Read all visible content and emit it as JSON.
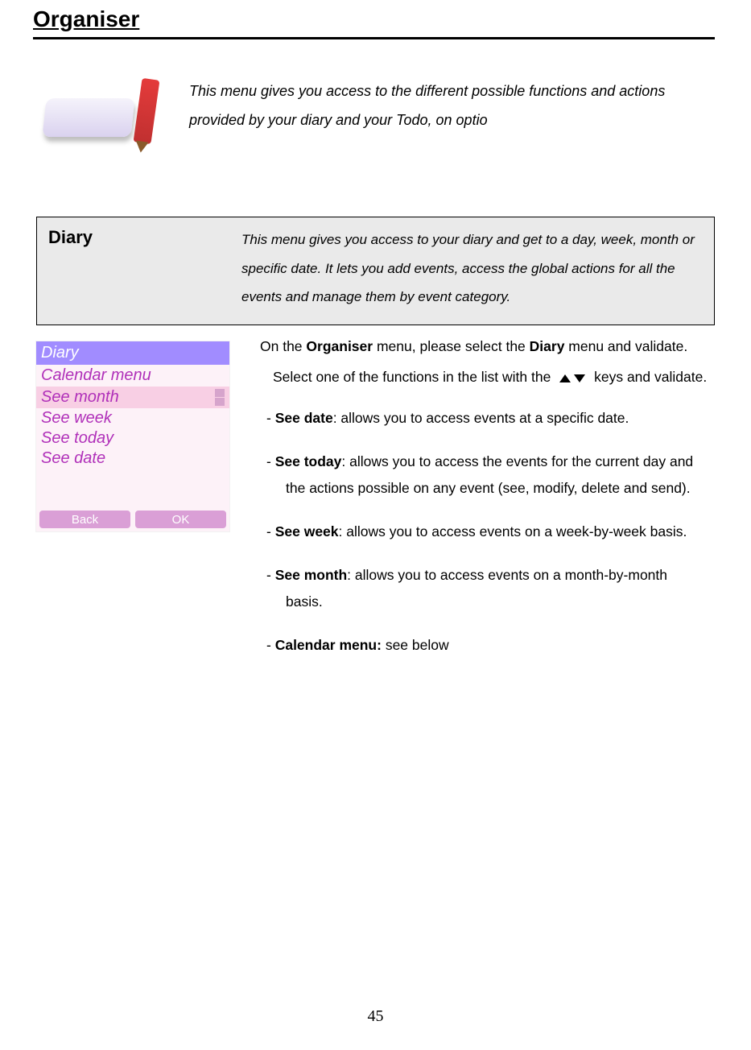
{
  "title": "Organiser",
  "intro_text": "This menu gives you access to the different possible functions and actions provided by your diary and your Todo, on optio",
  "diary": {
    "label": "Diary",
    "text": "This menu gives you access to your diary and get to a day, week, month or specific date. It lets you add events, access the global actions for all the events and manage them by event category."
  },
  "screenshot": {
    "header": "Diary",
    "subheader": "Calendar menu",
    "selected": "See month",
    "items": [
      "See week",
      "See today",
      "See date"
    ],
    "buttons": {
      "back": "Back",
      "ok": "OK"
    }
  },
  "body": {
    "lead_a": "On the ",
    "lead_bold_1": "Organiser",
    "lead_b": " menu, please select the ",
    "lead_bold_2": "Diary",
    "lead_c": " menu and validate.",
    "lead2_a": "Select one of the functions in the list with the ",
    "lead2_b": " keys and validate.",
    "items": [
      {
        "bold": "See date",
        "rest": ": allows you to access events at a specific date.",
        "cont": ""
      },
      {
        "bold": "See today",
        "rest": ": allows you to access the events for the current day and",
        "cont": "the actions possible on any event (see, modify, delete and send)."
      },
      {
        "bold": "See week",
        "rest": ": allows you to access events on a week-by-week basis.",
        "cont": ""
      },
      {
        "bold": "See month",
        "rest": ": allows you to access events on a month-by-month",
        "cont": "basis."
      },
      {
        "bold": "Calendar menu:",
        "rest": " see below",
        "cont": ""
      }
    ]
  },
  "page_number": "45"
}
